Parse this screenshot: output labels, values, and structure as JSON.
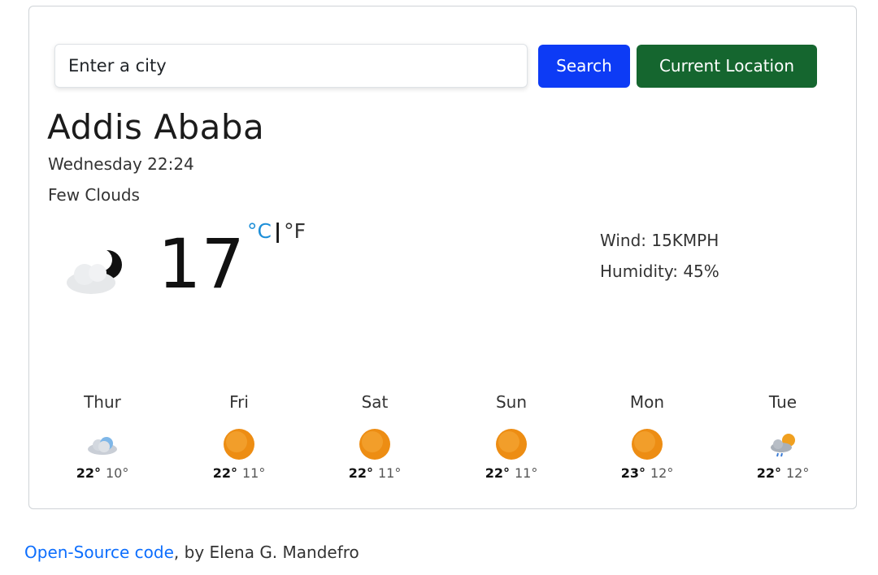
{
  "search": {
    "placeholder": "Enter a city",
    "search_label": "Search",
    "location_label": "Current Location"
  },
  "current": {
    "city": "Addis Ababa",
    "datetime": "Wednesday 22:24",
    "description": "Few Clouds",
    "icon": "cloud-night-icon",
    "temperature": "17",
    "unit_c": "°C",
    "unit_sep": "|",
    "unit_f": "°F",
    "wind": "Wind: 15KMPH",
    "humidity": "Humidity: 45%"
  },
  "forecast": [
    {
      "day": "Thur",
      "icon": "cloud-icon",
      "max": "22°",
      "min": "10°"
    },
    {
      "day": "Fri",
      "icon": "sun-icon",
      "max": "22°",
      "min": "11°"
    },
    {
      "day": "Sat",
      "icon": "sun-icon",
      "max": "22°",
      "min": "11°"
    },
    {
      "day": "Sun",
      "icon": "sun-icon",
      "max": "22°",
      "min": "11°"
    },
    {
      "day": "Mon",
      "icon": "sun-icon",
      "max": "23°",
      "min": "12°"
    },
    {
      "day": "Tue",
      "icon": "rain-sun-icon",
      "max": "22°",
      "min": "12°"
    }
  ],
  "footer": {
    "link_text": "Open-Source code",
    "byline": ", by Elena G. Mandefro"
  },
  "colors": {
    "search_button": "#0d3bf5",
    "location_button": "#15662f",
    "celsius": "#1e8fd8",
    "link": "#0d6efd",
    "sun": "#f09a1a"
  }
}
